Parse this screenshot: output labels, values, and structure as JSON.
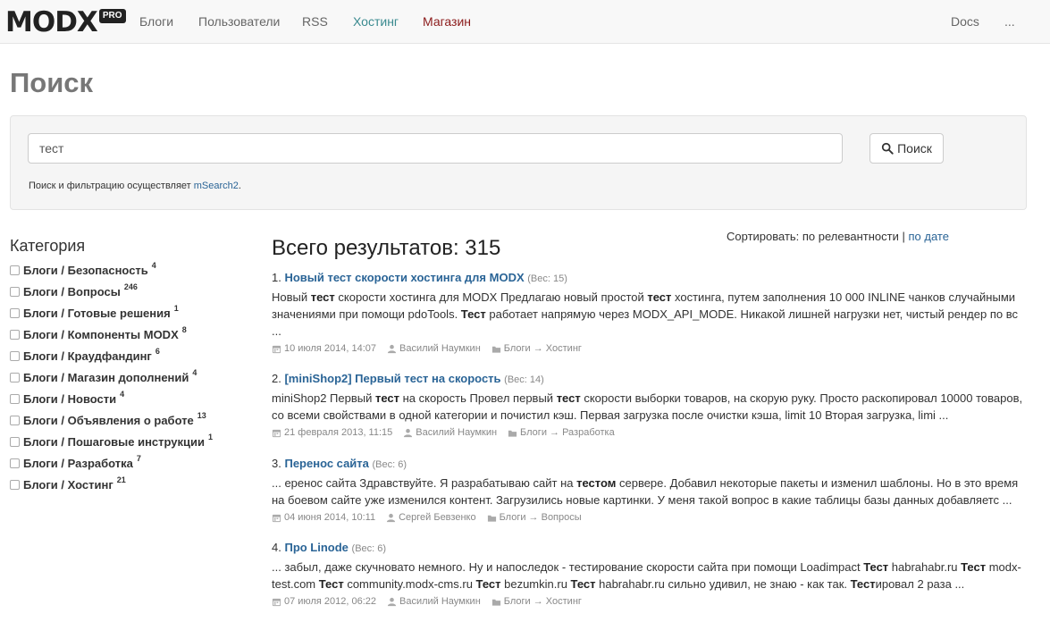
{
  "nav": {
    "logo": "MODX",
    "logo_badge": "PRO",
    "items": [
      "Блоги",
      "Пользователи",
      "RSS",
      "Хостинг",
      "Магазин"
    ],
    "right": [
      "Docs",
      "..."
    ]
  },
  "page_title": "Поиск",
  "search": {
    "query": "тест",
    "button": "Поиск",
    "note_prefix": "Поиск и фильтрацию осуществляет ",
    "note_link": "mSearch2",
    "note_suffix": "."
  },
  "sidebar": {
    "title": "Категория",
    "categories": [
      {
        "label": "Блоги / Безопасность",
        "count": "4"
      },
      {
        "label": "Блоги / Вопросы",
        "count": "246"
      },
      {
        "label": "Блоги / Готовые решения",
        "count": "1"
      },
      {
        "label": "Блоги / Компоненты MODX",
        "count": "8"
      },
      {
        "label": "Блоги / Краудфандинг",
        "count": "6"
      },
      {
        "label": "Блоги / Магазин дополнений",
        "count": "4"
      },
      {
        "label": "Блоги / Новости",
        "count": "4"
      },
      {
        "label": "Блоги / Объявления о работе",
        "count": "13"
      },
      {
        "label": "Блоги / Пошаговые инструкции",
        "count": "1"
      },
      {
        "label": "Блоги / Разработка",
        "count": "7"
      },
      {
        "label": "Блоги / Хостинг",
        "count": "21"
      }
    ]
  },
  "results": {
    "total": "Всего результатов: 315",
    "sort_label": "Сортировать: по релевантности",
    "sort_separator": " | ",
    "sort_by_date": "по дате",
    "items": [
      {
        "num": "1.",
        "title": "Новый тест скорости хостинга для MODX",
        "weight": "(Вес: 15)",
        "snippet": [
          {
            "t": "Новый "
          },
          {
            "t": "тест",
            "b": true
          },
          {
            "t": " скорости хостинга для MODX Предлагаю новый простой "
          },
          {
            "t": "тест",
            "b": true
          },
          {
            "t": " хостинга, путем заполнения 10 000 INLINE чанков случайными значениями при помощи pdoTools. "
          },
          {
            "t": "Тест",
            "b": true
          },
          {
            "t": " работает напрямую через MODX_API_MODE. Никакой лишней нагрузки нет, чистый рендер по вс ..."
          }
        ],
        "date": "10 июля 2014, 14:07",
        "author": "Василий Наумкин",
        "category": "Блоги → Хостинг"
      },
      {
        "num": "2.",
        "title": "[miniShop2] Первый тест на скорость",
        "weight": "(Вес: 14)",
        "snippet": [
          {
            "t": "miniShop2 Первый "
          },
          {
            "t": "тест",
            "b": true
          },
          {
            "t": " на скорость Провел первый "
          },
          {
            "t": "тест",
            "b": true
          },
          {
            "t": " скорости выборки товаров, на скорую руку. Просто раскопировал 10000 товаров, со всеми свойствами в одной категории и почистил кэш. Первая загрузка после очистки кэша, limit 10 Вторая загрузка, limi ..."
          }
        ],
        "date": "21 февраля 2013, 11:15",
        "author": "Василий Наумкин",
        "category": "Блоги → Разработка"
      },
      {
        "num": "3.",
        "title": "Перенос сайта",
        "weight": "(Вес: 6)",
        "snippet": [
          {
            "t": "... еренос сайта Здравствуйте. Я разрабатываю сайт на "
          },
          {
            "t": "тестом",
            "b": true
          },
          {
            "t": " сервере. Добавил некоторые пакеты и изменил шаблоны. Но в это время на боевом сайте уже изменился контент. Загрузились новые картинки. У меня такой вопрос в какие таблицы базы данных добавляетс ..."
          }
        ],
        "date": "04 июня 2014, 10:11",
        "author": "Сергей Бевзенко",
        "category": "Блоги → Вопросы"
      },
      {
        "num": "4.",
        "title": "Про Linode",
        "weight": "(Вес: 6)",
        "snippet": [
          {
            "t": "... забыл, даже скучновато немного. Ну и напоследок - тестирование скорости сайта при помощи Loadimpact "
          },
          {
            "t": "Тест",
            "b": true
          },
          {
            "t": " habrahabr.ru "
          },
          {
            "t": "Тест",
            "b": true
          },
          {
            "t": " modx-test.com "
          },
          {
            "t": "Тест",
            "b": true
          },
          {
            "t": " community.modx-cms.ru "
          },
          {
            "t": "Тест",
            "b": true
          },
          {
            "t": " bezumkin.ru "
          },
          {
            "t": "Тест",
            "b": true
          },
          {
            "t": " habrahabr.ru сильно удивил, не знаю - как так. "
          },
          {
            "t": "Тест",
            "b": true
          },
          {
            "t": "ировал 2 раза ..."
          }
        ],
        "date": "07 июля 2012, 06:22",
        "author": "Василий Наумкин",
        "category": "Блоги → Хостинг"
      }
    ]
  },
  "icons": {
    "search": "search-icon",
    "calendar": "calendar-icon",
    "user": "user-icon",
    "folder": "folder-icon"
  },
  "colors": {
    "link": "#2a6496",
    "hosting": "#3a8a8f",
    "shop": "#8b1a1a",
    "muted": "#888888"
  }
}
